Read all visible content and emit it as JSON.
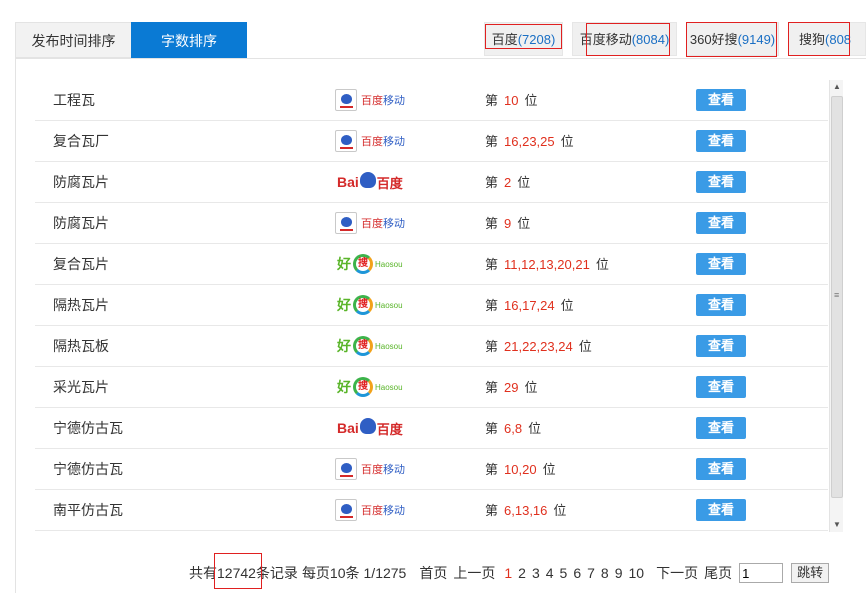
{
  "tabs": [
    {
      "label": "发布时间排序",
      "active": false
    },
    {
      "label": "字数排序",
      "active": true
    }
  ],
  "filters": [
    {
      "name": "百度",
      "count": "(7208)"
    },
    {
      "name": "百度移动",
      "count": "(8084)"
    },
    {
      "name": "360好搜",
      "count": "(9149)"
    },
    {
      "name": "搜狗",
      "count": "(808"
    }
  ],
  "engines": {
    "baidu_mobile": {
      "a": "百度",
      "b": "移动"
    },
    "baidu": {
      "a": "Bai",
      "b": "百度"
    },
    "haosou": {
      "a": "好",
      "ring": "搜",
      "sub": "Haosou"
    }
  },
  "rank_prefix": "第",
  "rank_suffix": "位",
  "view_label": "查看",
  "rows": [
    {
      "keyword": "工程瓦",
      "engine": "baidu_mobile",
      "ranks": "10"
    },
    {
      "keyword": "复合瓦厂",
      "engine": "baidu_mobile",
      "ranks": "16,23,25"
    },
    {
      "keyword": "防腐瓦片",
      "engine": "baidu",
      "ranks": "2"
    },
    {
      "keyword": "防腐瓦片",
      "engine": "baidu_mobile",
      "ranks": "9"
    },
    {
      "keyword": "复合瓦片",
      "engine": "haosou",
      "ranks": "11,12,13,20,21"
    },
    {
      "keyword": "隔热瓦片",
      "engine": "haosou",
      "ranks": "16,17,24"
    },
    {
      "keyword": "隔热瓦板",
      "engine": "haosou",
      "ranks": "21,22,23,24"
    },
    {
      "keyword": "采光瓦片",
      "engine": "haosou",
      "ranks": "29"
    },
    {
      "keyword": "宁德仿古瓦",
      "engine": "baidu",
      "ranks": "6,8"
    },
    {
      "keyword": "宁德仿古瓦",
      "engine": "baidu_mobile",
      "ranks": "10,20"
    },
    {
      "keyword": "南平仿古瓦",
      "engine": "baidu_mobile",
      "ranks": "6,13,16"
    }
  ],
  "pager": {
    "total_prefix": "共有",
    "total": "12742",
    "total_suffix": "条记录",
    "per_page": "每页10条",
    "page_info": "1/1275",
    "first": "首页",
    "prev": "上一页",
    "pages": [
      "1",
      "2",
      "3",
      "4",
      "5",
      "6",
      "7",
      "8",
      "9",
      "10"
    ],
    "current": "1",
    "next": "下一页",
    "last": "尾页",
    "input_value": "1",
    "go": "跳转"
  },
  "colors": {
    "tab_active": "#0a7ad4",
    "button": "#3a9be6",
    "rank_number": "#e0301e",
    "highlight_box": "#e02020"
  }
}
